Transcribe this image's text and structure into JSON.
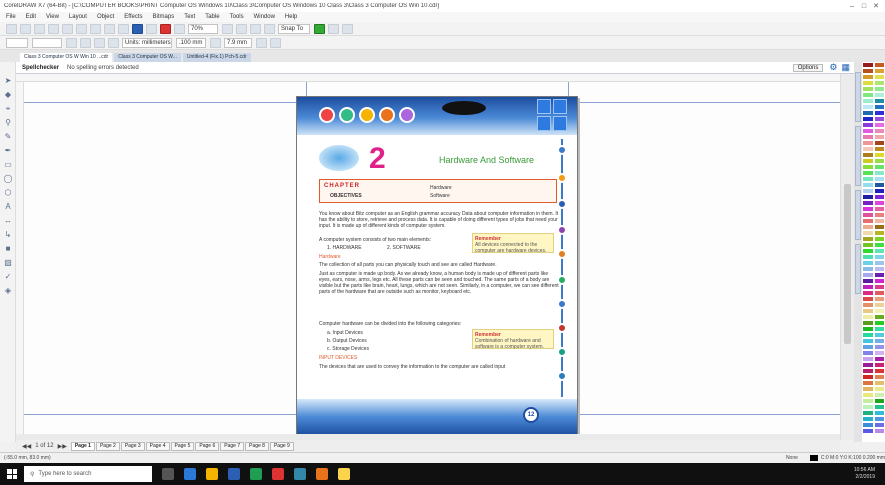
{
  "window": {
    "title": "CorelDRAW X7 (64-Bit) - [C:\\COMPUTER BOOKS\\PRINT Computer OS Windows 10\\Class 3\\Computer OS Windows 10 Class 3\\Class 3 Computer OS Win 10.cdr]"
  },
  "menu": [
    "File",
    "Edit",
    "View",
    "Layout",
    "Object",
    "Effects",
    "Bitmaps",
    "Text",
    "Table",
    "Tools",
    "Window",
    "Help"
  ],
  "toolbar": {
    "zoom": "70%",
    "size_value": "7.9 mm",
    "snap_label": "Snap To",
    "unit_label": "Units: millimeters",
    "offset_value": ".100 mm"
  },
  "doc_tabs": [
    {
      "label": "Class 3 Computer OS W Win 10 ...cdr",
      "active": true
    },
    {
      "label": "Class 3 Computer OS W...",
      "active": false
    },
    {
      "label": "Untitled-4 (Fix.1) Pch-5.cdr",
      "active": false
    }
  ],
  "spell": {
    "label": "Spellchecker",
    "message": "No spelling errors detected",
    "options_label": "Options"
  },
  "document": {
    "chapter_number": "2",
    "chapter_title": "Hardware And Software",
    "chapter_label": "CHAPTER",
    "objective_label": "OBJECTIVES",
    "objectives": [
      "Hardware",
      "Software"
    ],
    "intro": "You know about Bitz computer as an English grammar accuracy Data about computer information in them. It has the ability to store, retrieve and process data. It is capable of doing different types of jobs that need your input. It is made up of different kinds of computer system.",
    "parts_intro": "A computer system consists of two main elements:",
    "parts": [
      "1. HARDWARE",
      "2. SOFTWARE"
    ],
    "hardware_heading": "Hardware",
    "hardware_para": "The collection of all parts you can physically touch and see are called Hardware.",
    "hardware_para2": "Just as computer is made up body. As we already know, a human body is made up of different parts like eyes, ears, nose, arms, legs etc. All these parts can be seen and touched. The same parts of a body are visible but the parts like brain, heart, lungs, which are not seen. Similarly, in a computer, we can see different parts of the hardware that are outside such as monitor, keyboard etc.",
    "categories_intro": "Computer hardware can be divided into the following categories:",
    "categories": [
      "a. Input Devices",
      "b. Output Devices",
      "c. Storage Devices"
    ],
    "input_heading": "INPUT DEVICES",
    "input_para": "The devices that are used to convey the information to the computer are called input",
    "note1_title": "Remember",
    "note1_text": "All devices connected to the computer are hardware devices.",
    "note2_title": "Remember",
    "note2_text": "Combination of hardware and software is a computer system.",
    "page_number": "12"
  },
  "page_tabs": {
    "nav_label": "1 of 12",
    "pages": [
      "Page 1",
      "Page 2",
      "Page 3",
      "Page 4",
      "Page 5",
      "Page 6",
      "Page 7",
      "Page 8",
      "Page 9"
    ],
    "active_index": 0
  },
  "status": {
    "coords": "(-55.0 mm, 83.0 mm)",
    "fill": "None",
    "outline": "C:0 M:0 Y:0 K:100  0.200 mm"
  },
  "taskbar": {
    "search_placeholder": "Type here to search",
    "time": "10:56 AM",
    "date": "2/2/2019"
  },
  "colors": {
    "accent_blue": "#1d4e9f",
    "chapter_pink": "#e0218a",
    "title_green": "#3a9b3a",
    "orange": "#e05a2a"
  }
}
